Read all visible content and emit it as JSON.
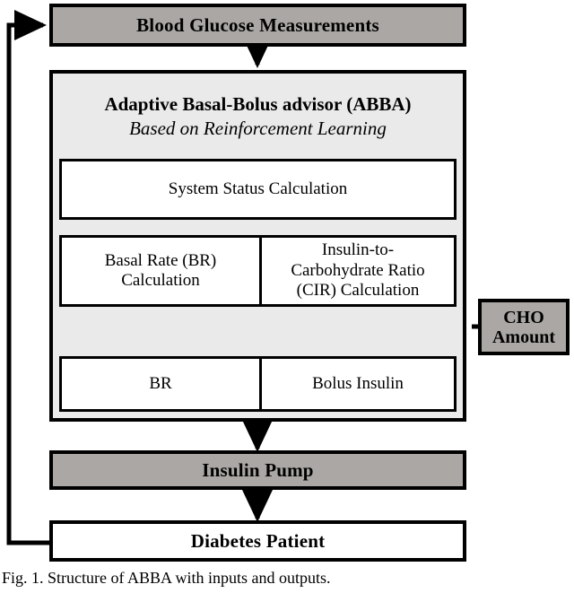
{
  "figure": {
    "caption": "Fig. 1. Structure of ABBA with inputs and outputs.",
    "colors": {
      "gray_fill": "#aaa7a4",
      "light_gray_fill": "#eaeaea",
      "white_fill": "#ffffff",
      "line": "#000000"
    }
  },
  "nodes": {
    "blood_glucose": {
      "label": "Blood Glucose Measurements",
      "fill": "gray"
    },
    "abba": {
      "title_line1": "Adaptive Basal-Bolus advisor (ABBA)",
      "title_line2": "Based on Reinforcement Learning",
      "fill": "light-gray",
      "children": {
        "system_status": {
          "label": "System Status Calculation",
          "fill": "white"
        },
        "basal_rate": {
          "label": "Basal Rate (BR) Calculation",
          "line1": "Basal Rate (BR)",
          "line2": "Calculation",
          "fill": "white"
        },
        "icr": {
          "label": "Insulin-to-Carbohydrate Ratio (CIR) Calculation",
          "line1": "Insulin-to-",
          "line2": "Carbohydrate  Ratio",
          "line3": "(CIR) Calculation",
          "fill": "white"
        },
        "br_output": {
          "label": "BR",
          "fill": "white"
        },
        "bolus_output": {
          "label": "Bolus Insulin",
          "fill": "white"
        }
      }
    },
    "cho_amount": {
      "line1": "CHO",
      "line2": "Amount",
      "label": "CHO Amount",
      "fill": "gray"
    },
    "insulin_pump": {
      "label": "Insulin Pump",
      "fill": "gray"
    },
    "diabetes_patient": {
      "label": "Diabetes Patient",
      "fill": "white"
    }
  },
  "edges": [
    {
      "name": "blood-glucose-to-abba",
      "from": "blood_glucose",
      "to": "abba",
      "style": "solid-arrow",
      "direction": "down"
    },
    {
      "name": "basal-rate-to-br",
      "from": "basal_rate",
      "to": "br_output",
      "style": "solid-arrow",
      "direction": "down"
    },
    {
      "name": "icr-to-bolus",
      "from": "icr",
      "to": "bolus_output",
      "style": "solid-arrow",
      "direction": "down"
    },
    {
      "name": "cho-to-abba",
      "from": "cho_amount",
      "to": "icr",
      "style": "dotted-arrow",
      "direction": "left"
    },
    {
      "name": "abba-to-insulin-pump",
      "from": "abba",
      "to": "insulin_pump",
      "style": "solid-arrow",
      "direction": "down"
    },
    {
      "name": "insulin-pump-to-patient",
      "from": "insulin_pump",
      "to": "diabetes_patient",
      "style": "solid-arrow",
      "direction": "down"
    },
    {
      "name": "patient-feedback-to-blood-glucose",
      "from": "diabetes_patient",
      "to": "blood_glucose",
      "style": "solid-arrow",
      "direction": "feedback-left"
    }
  ]
}
